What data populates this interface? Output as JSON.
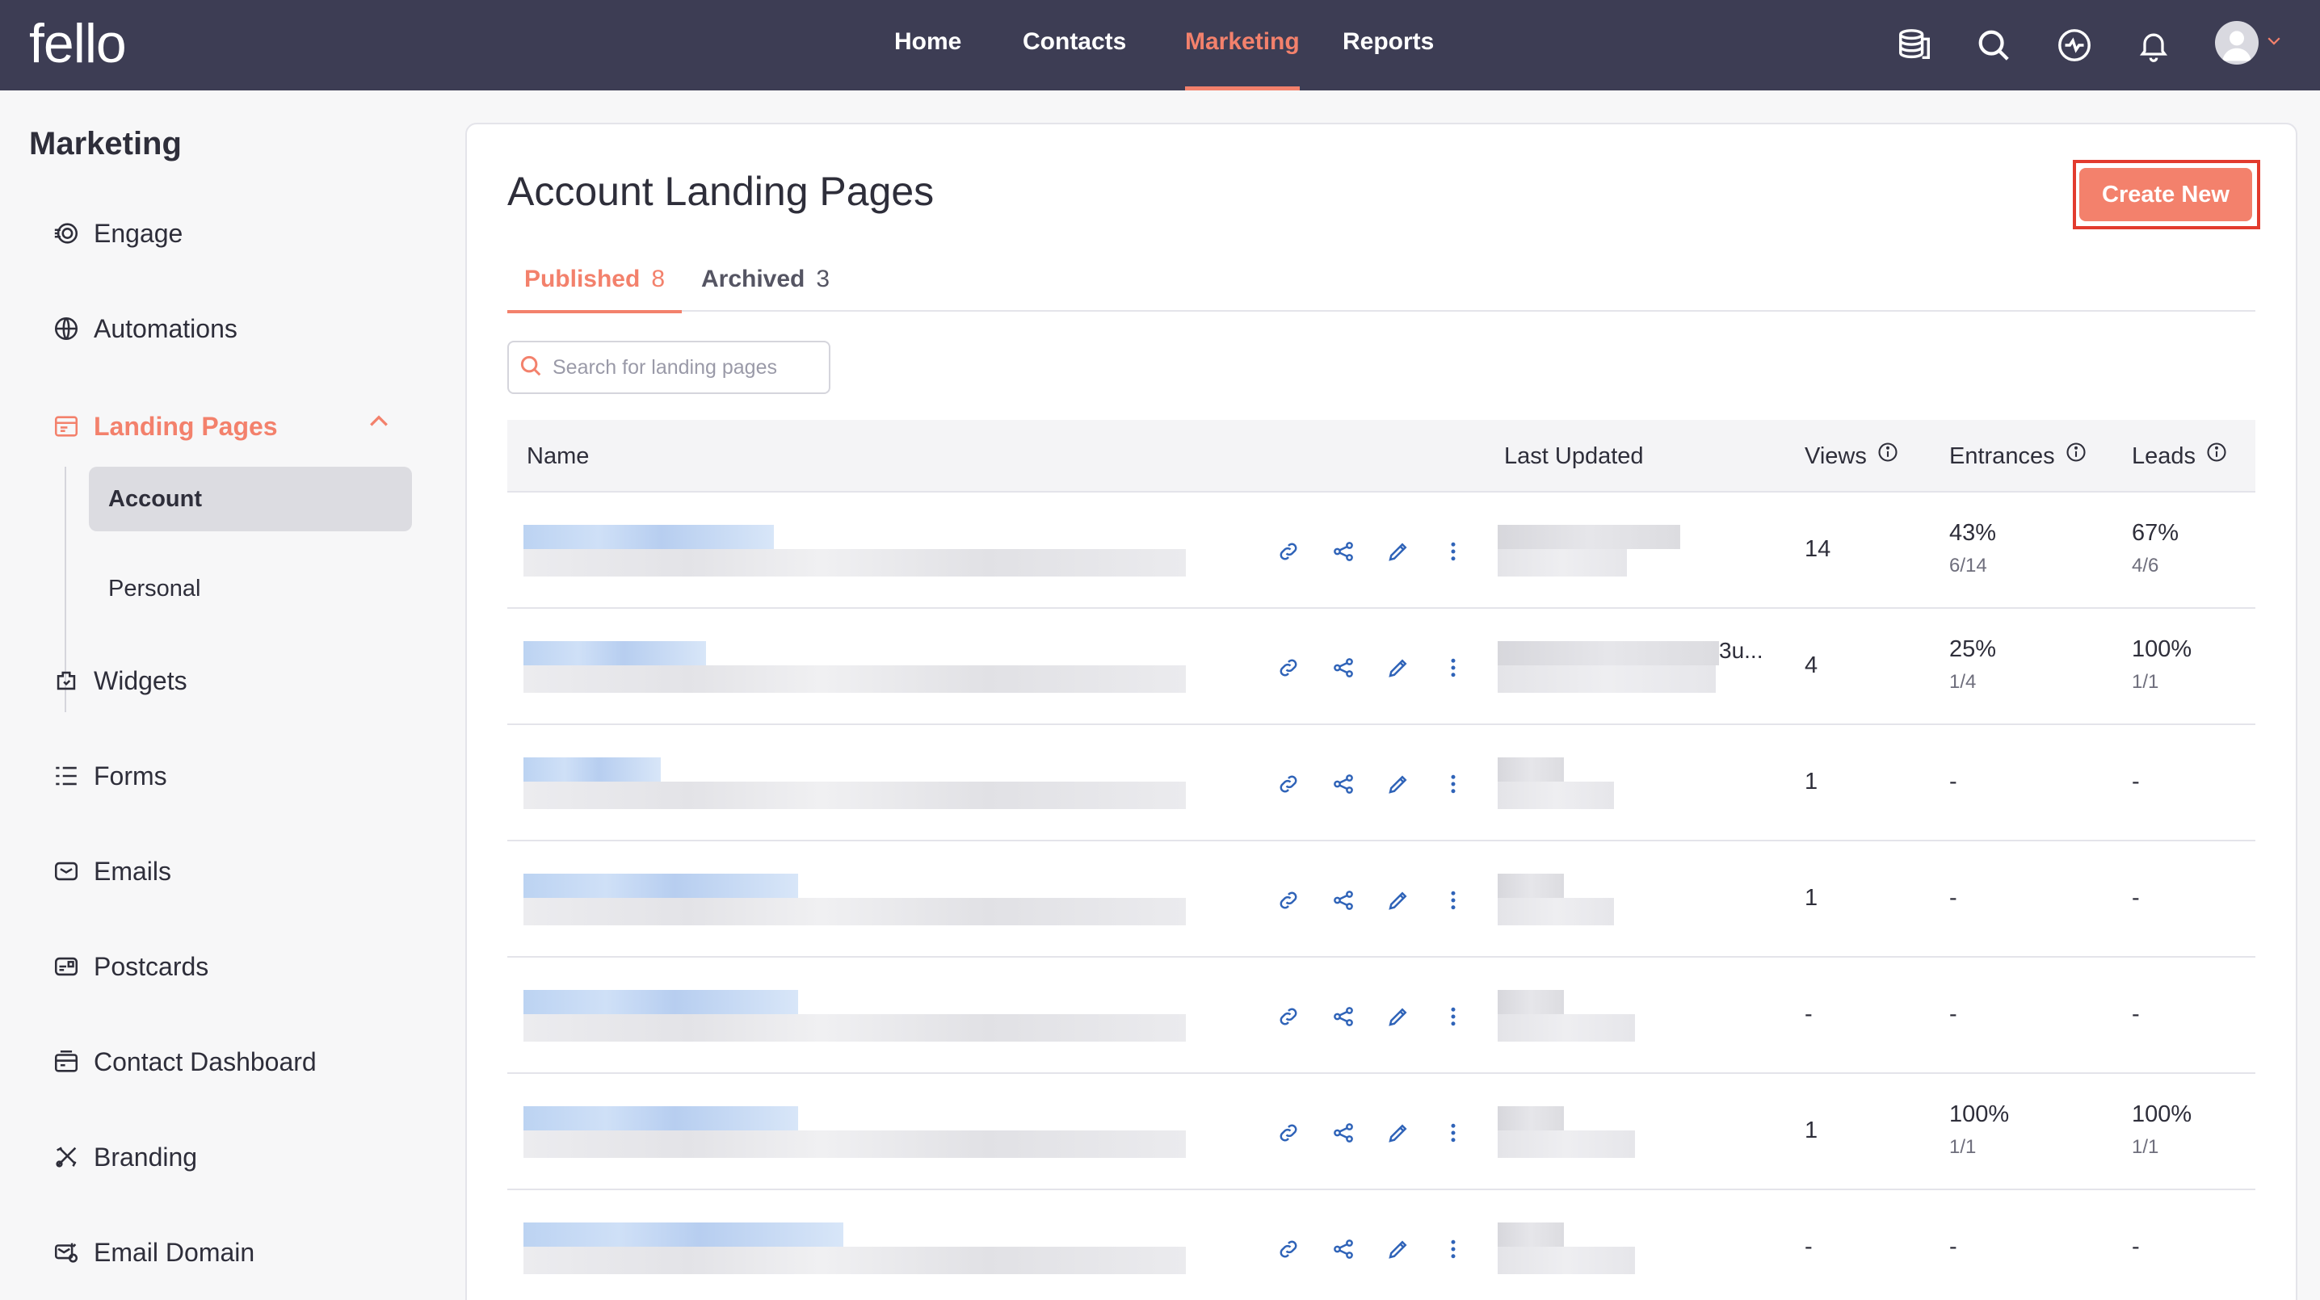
{
  "brand": {
    "logo_text": "fello",
    "accent": "#f3816c",
    "topbar_bg": "#3d3d54"
  },
  "nav": {
    "items": [
      {
        "label": "Home",
        "active": false
      },
      {
        "label": "Contacts",
        "active": false
      },
      {
        "label": "Marketing",
        "active": true
      },
      {
        "label": "Reports",
        "active": false
      }
    ],
    "icons": [
      "database-icon",
      "search-icon",
      "activity-icon",
      "bell-icon",
      "avatar-icon"
    ]
  },
  "sidebar": {
    "title": "Marketing",
    "items": [
      {
        "label": "Engage",
        "icon": "engage-icon"
      },
      {
        "label": "Automations",
        "icon": "automations-icon"
      },
      {
        "label": "Landing Pages",
        "icon": "landing-pages-icon",
        "active": true
      },
      {
        "label": "Widgets",
        "icon": "widgets-icon"
      },
      {
        "label": "Forms",
        "icon": "forms-icon"
      },
      {
        "label": "Emails",
        "icon": "emails-icon"
      },
      {
        "label": "Postcards",
        "icon": "postcards-icon"
      },
      {
        "label": "Contact Dashboard",
        "icon": "contact-dashboard-icon"
      },
      {
        "label": "Branding",
        "icon": "branding-icon"
      },
      {
        "label": "Email Domain",
        "icon": "email-domain-icon"
      }
    ],
    "sub_items": [
      {
        "label": "Account",
        "active": true
      },
      {
        "label": "Personal",
        "active": false
      }
    ]
  },
  "main": {
    "title": "Account Landing Pages",
    "create_label": "Create New",
    "tabs": [
      {
        "label": "Published",
        "count": "8",
        "active": true
      },
      {
        "label": "Archived",
        "count": "3",
        "active": false
      }
    ],
    "search_placeholder": "Search for landing pages",
    "columns": {
      "name": "Name",
      "last_updated": "Last Updated",
      "views": "Views",
      "entrances": "Entrances",
      "leads": "Leads"
    },
    "rows": [
      {
        "views": "14",
        "entrances": "43%",
        "entrances_sub": "6/14",
        "leads": "67%",
        "leads_sub": "4/6",
        "date_suffix": ""
      },
      {
        "views": "4",
        "entrances": "25%",
        "entrances_sub": "1/4",
        "leads": "100%",
        "leads_sub": "1/1",
        "date_suffix": "3u..."
      },
      {
        "views": "1",
        "entrances": "-",
        "entrances_sub": "",
        "leads": "-",
        "leads_sub": "",
        "date_suffix": ""
      },
      {
        "views": "1",
        "entrances": "-",
        "entrances_sub": "",
        "leads": "-",
        "leads_sub": "",
        "date_suffix": ""
      },
      {
        "views": "-",
        "entrances": "-",
        "entrances_sub": "",
        "leads": "-",
        "leads_sub": "",
        "date_suffix": ""
      },
      {
        "views": "1",
        "entrances": "100%",
        "entrances_sub": "1/1",
        "leads": "100%",
        "leads_sub": "1/1",
        "date_suffix": ""
      },
      {
        "views": "-",
        "entrances": "-",
        "entrances_sub": "",
        "leads": "-",
        "leads_sub": "",
        "date_suffix": ""
      }
    ]
  }
}
